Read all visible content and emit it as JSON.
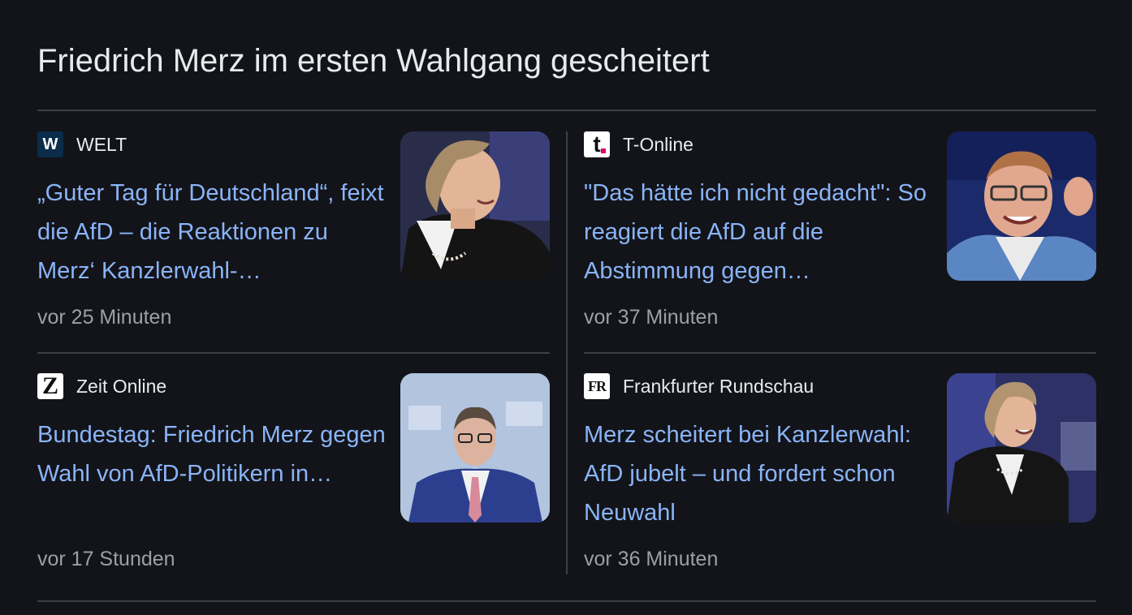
{
  "section": {
    "title": "Friedrich Merz im ersten Wahlgang gescheitert"
  },
  "articles": [
    {
      "source": "WELT",
      "source_icon_letter": "W",
      "headline": "„Guter Tag für Deutschland“, feixt die AfD – die Reaktionen zu Merz‘ Kanzlerwahl-…",
      "time": "vor 25 Minuten"
    },
    {
      "source": "T-Online",
      "source_icon_letter": "t",
      "headline": "\"Das hätte ich nicht gedacht\": So reagiert die AfD auf die Abstimmung gegen…",
      "time": "vor 37 Minuten"
    },
    {
      "source": "Zeit Online",
      "source_icon_letter": "Z",
      "headline": "Bundestag: Friedrich Merz gegen Wahl von AfD-Politikern in…",
      "time": "vor 17 Stunden"
    },
    {
      "source": "Frankfurter Rundschau",
      "source_icon_letter": "FR",
      "headline": "Merz scheitert bei Kanzlerwahl: AfD jubelt – und fordert schon Neuwahl",
      "time": "vor 36 Minuten"
    }
  ],
  "colors": {
    "background": "#131419",
    "headline": "#8ab4f8",
    "source_text": "#e8eaed",
    "time_text": "#9aa0a6",
    "divider": "#3c4043",
    "tonline_accent": "#e5006d"
  }
}
